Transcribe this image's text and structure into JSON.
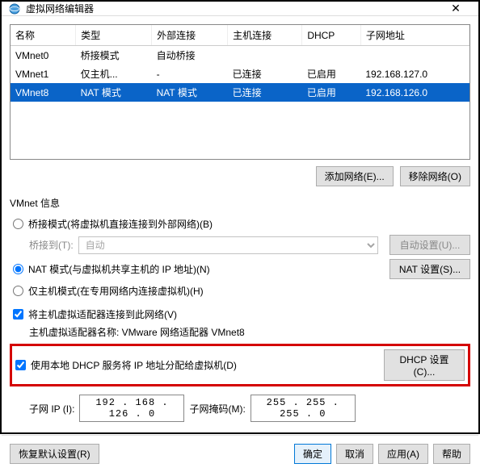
{
  "window": {
    "title": "虚拟网络编辑器"
  },
  "table": {
    "headers": [
      "名称",
      "类型",
      "外部连接",
      "主机连接",
      "DHCP",
      "子网地址"
    ],
    "rows": [
      {
        "name": "VMnet0",
        "type": "桥接模式",
        "ext": "自动桥接",
        "host": "",
        "dhcp": "",
        "subnet": "",
        "selected": false
      },
      {
        "name": "VMnet1",
        "type": "仅主机...",
        "ext": "-",
        "host": "已连接",
        "dhcp": "已启用",
        "subnet": "192.168.127.0",
        "selected": false
      },
      {
        "name": "VMnet8",
        "type": "NAT 模式",
        "ext": "NAT 模式",
        "host": "已连接",
        "dhcp": "已启用",
        "subnet": "192.168.126.0",
        "selected": true
      }
    ]
  },
  "buttons": {
    "add_net": "添加网络(E)...",
    "remove_net": "移除网络(O)",
    "auto_set": "自动设置(U)...",
    "nat_set": "NAT 设置(S)...",
    "dhcp_set": "DHCP 设置(C)...",
    "restore": "恢复默认设置(R)",
    "ok": "确定",
    "cancel": "取消",
    "apply": "应用(A)",
    "help": "帮助"
  },
  "labels": {
    "vmnet_info": "VMnet 信息",
    "bridge_radio": "桥接模式(将虚拟机直接连接到外部网络)(B)",
    "bridge_to": "桥接到(T):",
    "bridge_select": "自动",
    "nat_radio": "NAT 模式(与虚拟机共享主机的 IP 地址)(N)",
    "host_only_radio": "仅主机模式(在专用网络内连接虚拟机)(H)",
    "connect_host": "将主机虚拟适配器连接到此网络(V)",
    "adapter_name": "主机虚拟适配器名称: VMware 网络适配器 VMnet8",
    "use_dhcp": "使用本地 DHCP 服务将 IP 地址分配给虚拟机(D)",
    "subnet_ip": "子网 IP (I):",
    "subnet_mask": "子网掩码(M):"
  },
  "ip": {
    "subnet": "192 . 168 . 126 .  0",
    "mask": "255 . 255 . 255 .  0"
  }
}
